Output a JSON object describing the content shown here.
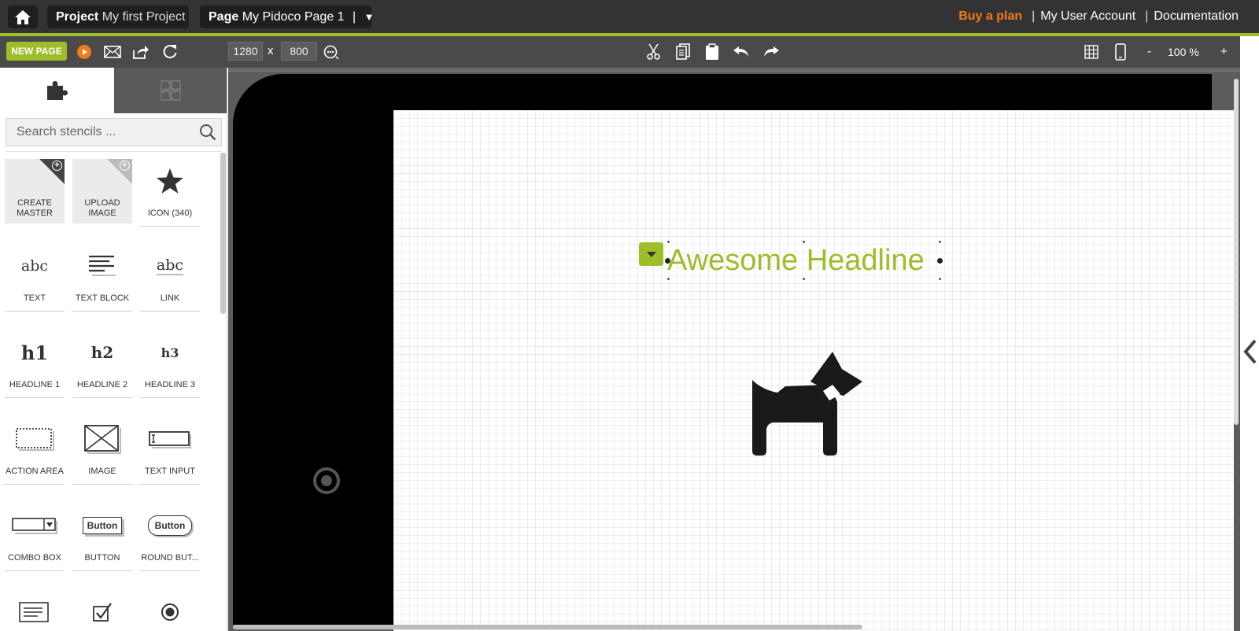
{
  "header": {
    "project_prefix": "Project",
    "project_name": "My first Project",
    "page_prefix": "Page",
    "page_name": "My Pidoco Page 1",
    "page_sep": "|",
    "page_dropdown": "▼",
    "buy_plan": "Buy a plan",
    "sep": "|",
    "user_account": "My User Account",
    "documentation": "Documentation"
  },
  "toolbar": {
    "new_page": "NEW PAGE",
    "width": "1280",
    "times": "x",
    "height": "800",
    "zoom_minus": "-",
    "zoom_level": "100 %",
    "zoom_plus": "+"
  },
  "sidebar": {
    "search_placeholder": "Search stencils ...",
    "stencils": [
      {
        "label": "CREATE MASTER",
        "icon": "create-master-icon"
      },
      {
        "label": "UPLOAD IMAGE",
        "icon": "upload-image-icon"
      },
      {
        "label": "ICON (340)",
        "icon": "star-icon"
      },
      {
        "label": "TEXT",
        "icon": "text-icon"
      },
      {
        "label": "TEXT BLOCK",
        "icon": "text-block-icon"
      },
      {
        "label": "LINK",
        "icon": "link-icon"
      },
      {
        "label": "HEADLINE 1",
        "icon": "h1-icon"
      },
      {
        "label": "HEADLINE 2",
        "icon": "h2-icon"
      },
      {
        "label": "HEADLINE 3",
        "icon": "h3-icon"
      },
      {
        "label": "ACTION AREA",
        "icon": "action-area-icon"
      },
      {
        "label": "IMAGE",
        "icon": "image-icon"
      },
      {
        "label": "TEXT INPUT",
        "icon": "text-input-icon"
      },
      {
        "label": "COMBO BOX",
        "icon": "combo-box-icon"
      },
      {
        "label": "BUTTON",
        "icon": "button-icon"
      },
      {
        "label": "ROUND BUT...",
        "icon": "round-button-icon"
      }
    ],
    "stencil_glyphs": {
      "abc": "abc",
      "h1": "h1",
      "h2": "h2",
      "h3": "h3",
      "button": "Button",
      "combo_arrow": "▼",
      "cursor": "I"
    }
  },
  "canvas": {
    "headline": "Awesome Headline"
  },
  "colors": {
    "accent": "#9dbd2a",
    "buy": "#f27a18",
    "header_bg": "#333333",
    "toolbar_bg": "#4a4a4a"
  }
}
